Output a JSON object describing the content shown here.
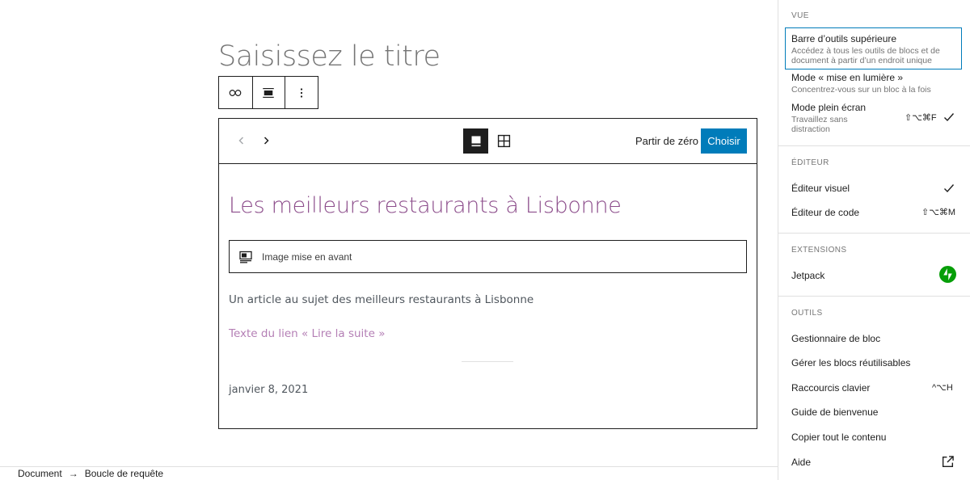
{
  "editor": {
    "title_placeholder": "Saisissez le titre",
    "pattern": {
      "start_blank_label": "Partir de zéro",
      "choose_label": "Choisir",
      "post_title": "Les meilleurs restaurants à Lisbonne",
      "featured_image_label": "Image mise en avant",
      "excerpt": "Un article au sujet des meilleurs restaurants à Lisbonne",
      "read_more": "Texte du lien « Lire la suite »",
      "date": "janvier 8, 2021"
    }
  },
  "breadcrumb": [
    "Document",
    "Boucle de requête"
  ],
  "options_menu": {
    "view": {
      "heading": "Vue",
      "items": [
        {
          "label": "Barre d’outils supérieure",
          "description": "Accédez à tous les outils de blocs et de document à partir d’un endroit unique"
        },
        {
          "label": "Mode « mise en lumière »",
          "description": "Concentrez-vous sur un bloc à la fois"
        },
        {
          "label": "Mode plein écran",
          "description": "Travaillez sans distraction",
          "shortcut": "⇧⌥⌘F"
        }
      ]
    },
    "editor": {
      "heading": "Éditeur",
      "items": [
        {
          "label": "Éditeur visuel"
        },
        {
          "label": "Éditeur de code",
          "shortcut": "⇧⌥⌘M"
        }
      ]
    },
    "extensions": {
      "heading": "Extensions",
      "items": [
        {
          "label": "Jetpack"
        }
      ]
    },
    "tools": {
      "heading": "Outils",
      "items": [
        {
          "label": "Gestionnaire de bloc"
        },
        {
          "label": "Gérer les blocs réutilisables"
        },
        {
          "label": "Raccourcis clavier",
          "shortcut": "^⌥H"
        },
        {
          "label": "Guide de bienvenue"
        },
        {
          "label": "Copier tout le contenu"
        },
        {
          "label": "Aide"
        }
      ]
    }
  },
  "colors": {
    "accent": "#007cba",
    "pattern_title": "#8c4d8b",
    "read_more": "#b47fb5",
    "jetpack": "#069e08"
  }
}
